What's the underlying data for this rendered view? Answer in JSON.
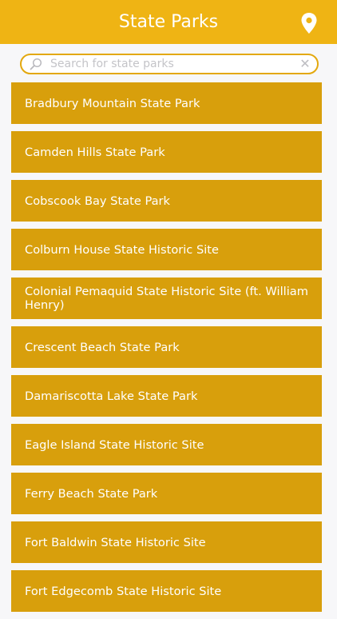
{
  "header": {
    "title": "State Parks",
    "pin_icon": "map-pin-icon"
  },
  "search": {
    "placeholder": "Search for state parks",
    "value": "",
    "search_icon": "magnifier-icon",
    "clear_icon": "clear-x-icon",
    "clear_glyph": "✕"
  },
  "colors": {
    "header": "#efb414",
    "list_item": "#d89f0c",
    "background": "#f7f7f9"
  },
  "parks": [
    "Bradbury Mountain State Park",
    "Camden Hills State Park",
    "Cobscook Bay State Park",
    "Colburn House State Historic Site",
    "Colonial Pemaquid State Historic Site (ft. William Henry)",
    "Crescent Beach State Park",
    "Damariscotta Lake State Park",
    "Eagle Island State Historic Site",
    "Ferry Beach State Park",
    "Fort Baldwin State Historic Site",
    "Fort Edgecomb State Historic Site"
  ]
}
